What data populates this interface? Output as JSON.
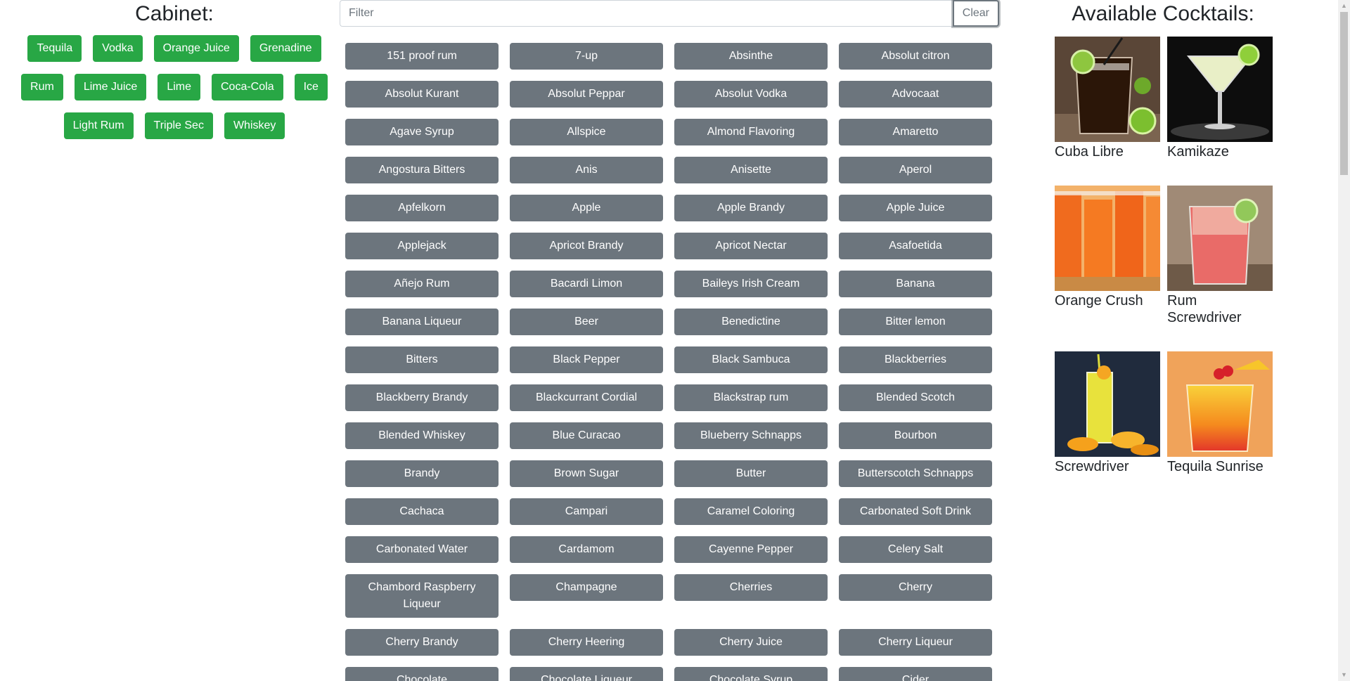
{
  "cabinet": {
    "title": "Cabinet:",
    "items": [
      "Tequila",
      "Vodka",
      "Orange Juice",
      "Grenadine",
      "Rum",
      "Lime Juice",
      "Lime",
      "Coca-Cola",
      "Ice",
      "Light Rum",
      "Triple Sec",
      "Whiskey"
    ],
    "button_color": "#28a745"
  },
  "filter": {
    "placeholder": "Filter",
    "value": "",
    "clear_label": "Clear"
  },
  "ingredients": {
    "button_color": "#6c757d",
    "items": [
      "151 proof rum",
      "7-up",
      "Absinthe",
      "Absolut citron",
      "Absolut Kurant",
      "Absolut Peppar",
      "Absolut Vodka",
      "Advocaat",
      "Agave Syrup",
      "Allspice",
      "Almond Flavoring",
      "Amaretto",
      "Angostura Bitters",
      "Anis",
      "Anisette",
      "Aperol",
      "Apfelkorn",
      "Apple",
      "Apple Brandy",
      "Apple Juice",
      "Applejack",
      "Apricot Brandy",
      "Apricot Nectar",
      "Asafoetida",
      "Añejo Rum",
      "Bacardi Limon",
      "Baileys Irish Cream",
      "Banana",
      "Banana Liqueur",
      "Beer",
      "Benedictine",
      "Bitter lemon",
      "Bitters",
      "Black Pepper",
      "Black Sambuca",
      "Blackberries",
      "Blackberry Brandy",
      "Blackcurrant Cordial",
      "Blackstrap rum",
      "Blended Scotch",
      "Blended Whiskey",
      "Blue Curacao",
      "Blueberry Schnapps",
      "Bourbon",
      "Brandy",
      "Brown Sugar",
      "Butter",
      "Butterscotch Schnapps",
      "Cachaca",
      "Campari",
      "Caramel Coloring",
      "Carbonated Soft Drink",
      "Carbonated Water",
      "Cardamom",
      "Cayenne Pepper",
      "Celery Salt",
      "Chambord Raspberry Liqueur",
      "Champagne",
      "Cherries",
      "Cherry",
      "Cherry Brandy",
      "Cherry Heering",
      "Cherry Juice",
      "Cherry Liqueur",
      "Chocolate",
      "Chocolate Liqueur",
      "Chocolate Syrup",
      "Cider"
    ]
  },
  "cocktails": {
    "title": "Available Cocktails:",
    "items": [
      {
        "name": "Cuba Libre",
        "image": "cuba-libre-photo"
      },
      {
        "name": "Kamikaze",
        "image": "kamikaze-photo"
      },
      {
        "name": "Orange Crush",
        "image": "orange-crush-photo"
      },
      {
        "name": "Rum Screwdriver",
        "image": "rum-screwdriver-photo"
      },
      {
        "name": "Screwdriver",
        "image": "screwdriver-photo"
      },
      {
        "name": "Tequila Sunrise",
        "image": "tequila-sunrise-photo"
      }
    ]
  }
}
